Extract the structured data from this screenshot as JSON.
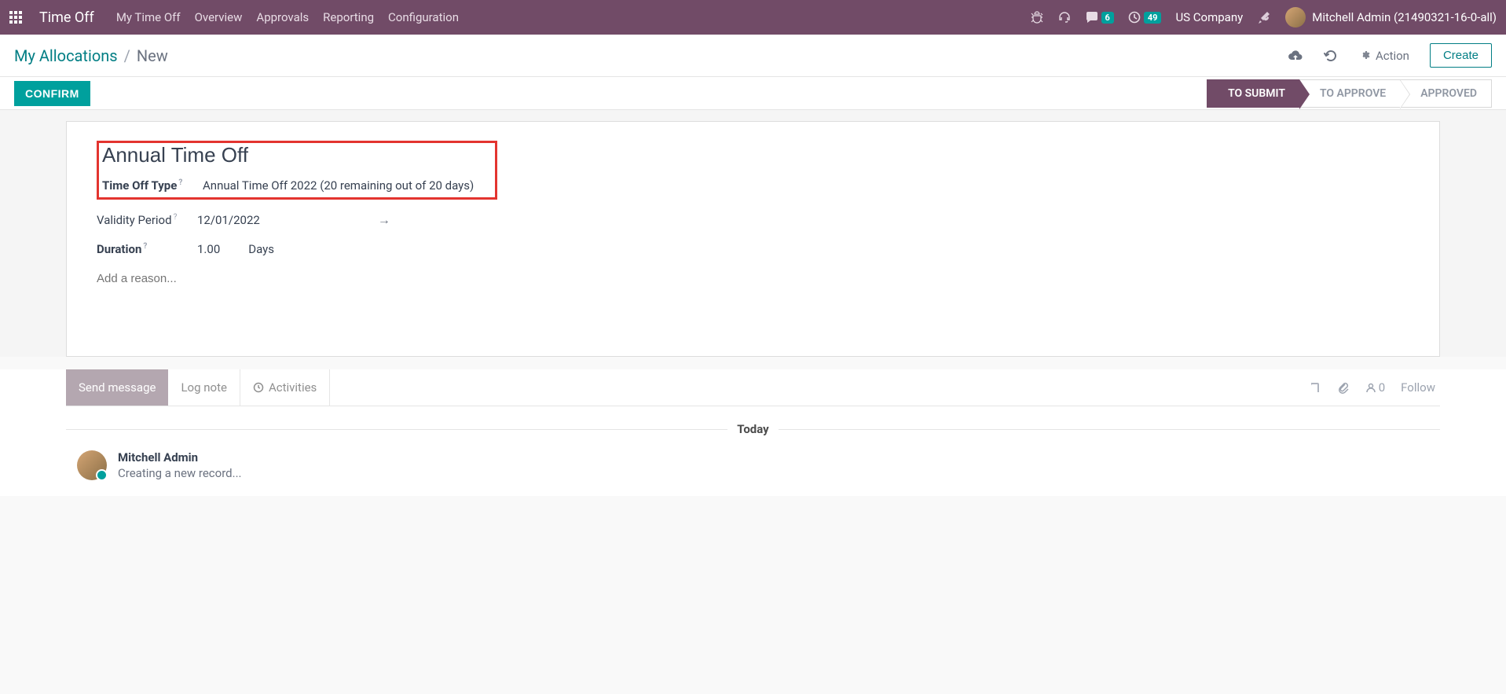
{
  "nav": {
    "app": "Time Off",
    "items": [
      "My Time Off",
      "Overview",
      "Approvals",
      "Reporting",
      "Configuration"
    ],
    "messages_badge": "6",
    "activities_badge": "49",
    "company": "US Company",
    "user": "Mitchell Admin (21490321-16-0-all)"
  },
  "breadcrumb": {
    "parent": "My Allocations",
    "current": "New"
  },
  "actions": {
    "action_label": "Action",
    "create_label": "Create",
    "confirm_label": "CONFIRM"
  },
  "status": {
    "steps": [
      "TO SUBMIT",
      "TO APPROVE",
      "APPROVED"
    ],
    "active_index": 0
  },
  "form": {
    "title": "Annual Time Off",
    "type_label": "Time Off Type",
    "type_value": "Annual Time Off 2022 (20 remaining out of 20 days)",
    "validity_label": "Validity Period",
    "validity_from": "12/01/2022",
    "duration_label": "Duration",
    "duration_value": "1.00",
    "duration_unit": "Days",
    "reason_placeholder": "Add a reason..."
  },
  "chatter": {
    "send_message": "Send message",
    "log_note": "Log note",
    "activities": "Activities",
    "followers": "0",
    "follow": "Follow",
    "today": "Today",
    "author": "Mitchell Admin",
    "creating": "Creating a new record..."
  }
}
